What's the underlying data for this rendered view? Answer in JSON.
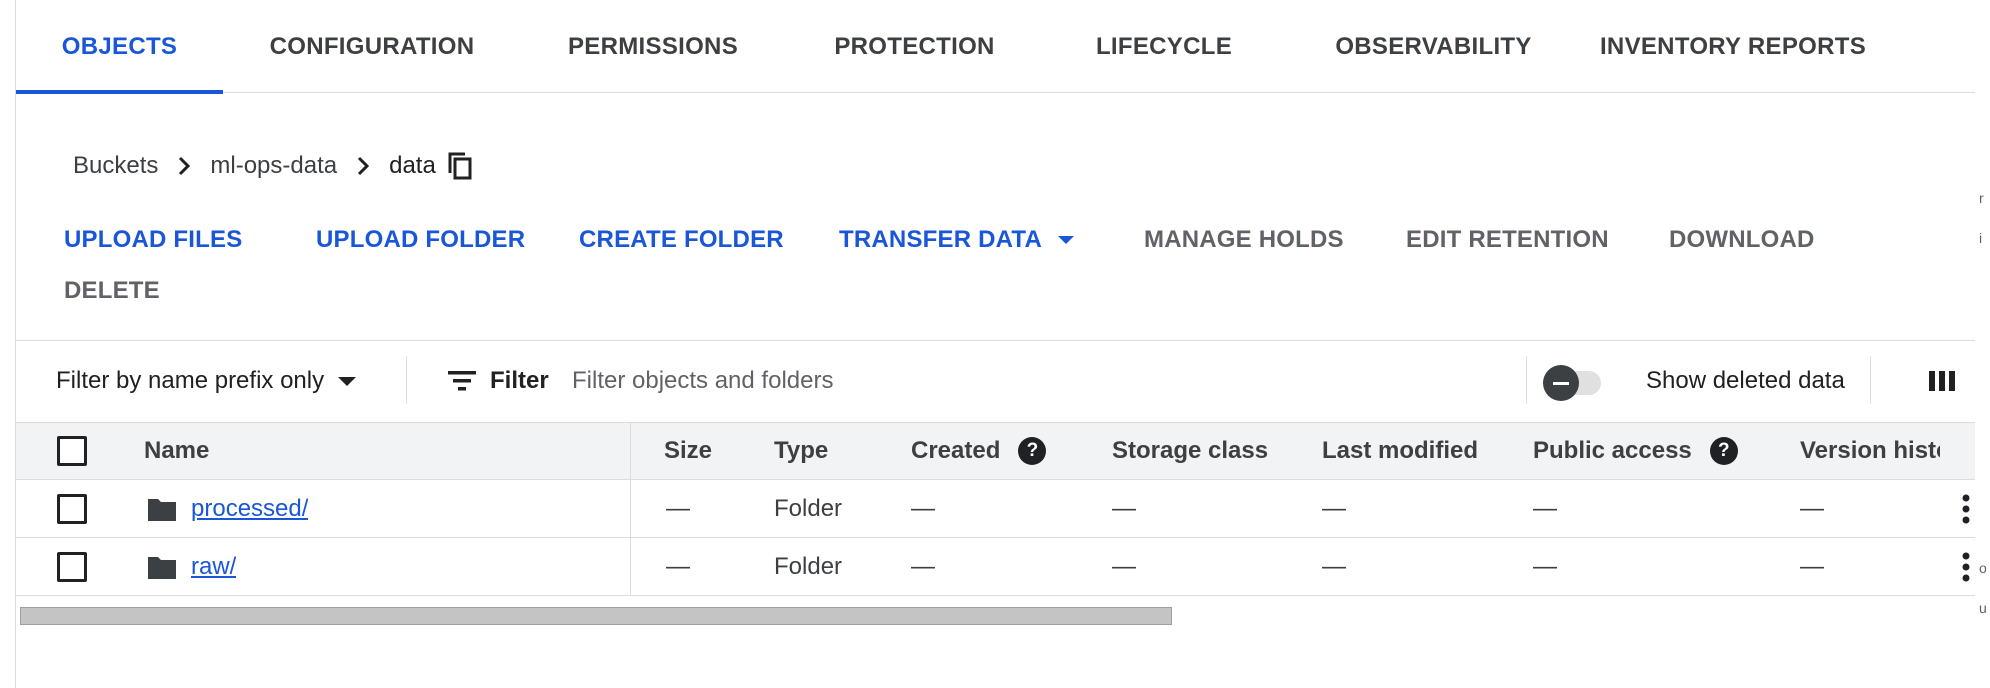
{
  "tabs": [
    {
      "label": "OBJECTS"
    },
    {
      "label": "CONFIGURATION"
    },
    {
      "label": "PERMISSIONS"
    },
    {
      "label": "PROTECTION"
    },
    {
      "label": "LIFECYCLE"
    },
    {
      "label": "OBSERVABILITY"
    },
    {
      "label": "INVENTORY REPORTS"
    }
  ],
  "breadcrumb": {
    "root": "Buckets",
    "bucket": "ml-ops-data",
    "current": "data"
  },
  "actions": {
    "upload_files": "UPLOAD FILES",
    "upload_folder": "UPLOAD FOLDER",
    "create_folder": "CREATE FOLDER",
    "transfer_data": "TRANSFER DATA",
    "manage_holds": "MANAGE HOLDS",
    "edit_retention": "EDIT RETENTION",
    "download": "DOWNLOAD",
    "delete": "DELETE"
  },
  "filter": {
    "mode": "Filter by name prefix only",
    "label": "Filter",
    "placeholder": "Filter objects and folders",
    "show_deleted": "Show deleted data"
  },
  "table": {
    "headers": {
      "name": "Name",
      "size": "Size",
      "type": "Type",
      "created": "Created",
      "storage_class": "Storage class",
      "last_modified": "Last modified",
      "public_access": "Public access",
      "version_history": "Version histo"
    },
    "rows": [
      {
        "name": "processed/",
        "size": "—",
        "type": "Folder",
        "created": "—",
        "storage_class": "—",
        "last_modified": "—",
        "public_access": "—",
        "version_history": "—"
      },
      {
        "name": "raw/",
        "size": "—",
        "type": "Folder",
        "created": "—",
        "storage_class": "—",
        "last_modified": "—",
        "public_access": "—",
        "version_history": "—"
      }
    ]
  },
  "help_glyph": "?",
  "edge_glyphs": [
    "r",
    "i",
    "o",
    "u"
  ],
  "colors": {
    "accent": "#1a56d8",
    "text": "#202124",
    "muted": "#5f6368",
    "border": "#dadce0",
    "header_bg": "#f1f3f4"
  }
}
